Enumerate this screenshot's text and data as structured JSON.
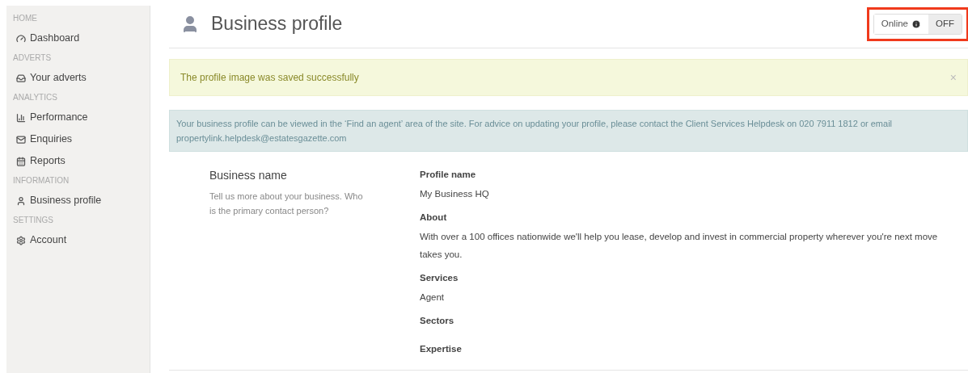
{
  "sidebar": {
    "sections": [
      {
        "heading": "HOME",
        "items": [
          {
            "label": "Dashboard"
          }
        ]
      },
      {
        "heading": "ADVERTS",
        "items": [
          {
            "label": "Your adverts"
          }
        ]
      },
      {
        "heading": "ANALYTICS",
        "items": [
          {
            "label": "Performance"
          },
          {
            "label": "Enquiries"
          },
          {
            "label": "Reports"
          }
        ]
      },
      {
        "heading": "INFORMATION",
        "items": [
          {
            "label": "Business profile"
          }
        ]
      },
      {
        "heading": "SETTINGS",
        "items": [
          {
            "label": "Account"
          }
        ]
      }
    ]
  },
  "page_title": "Business profile",
  "status_toggle": {
    "label": "Online",
    "value": "OFF",
    "on": false,
    "highlighted": true
  },
  "success_alert": {
    "text": "The profile image was saved successfully",
    "close": "×"
  },
  "info_alert": {
    "text": "Your business profile can be viewed in the ‘Find an agent’ area of the site. For advice on updating your profile, please contact the Client Services Helpdesk on 020 7911 1812 or email propertylink.helpdesk@estatesgazette.com"
  },
  "section": {
    "title": "Business name",
    "description": "Tell us more about your business. Who is the primary contact person?"
  },
  "fields": [
    {
      "label": "Profile name",
      "value": "My Business HQ"
    },
    {
      "label": "About",
      "value": "With over a 100 offices nationwide we'll help you lease, develop and invest in commercial property wherever you're next move takes you."
    },
    {
      "label": "Services",
      "value": "Agent"
    },
    {
      "label": "Sectors"
    },
    {
      "label": "Expertise"
    }
  ]
}
